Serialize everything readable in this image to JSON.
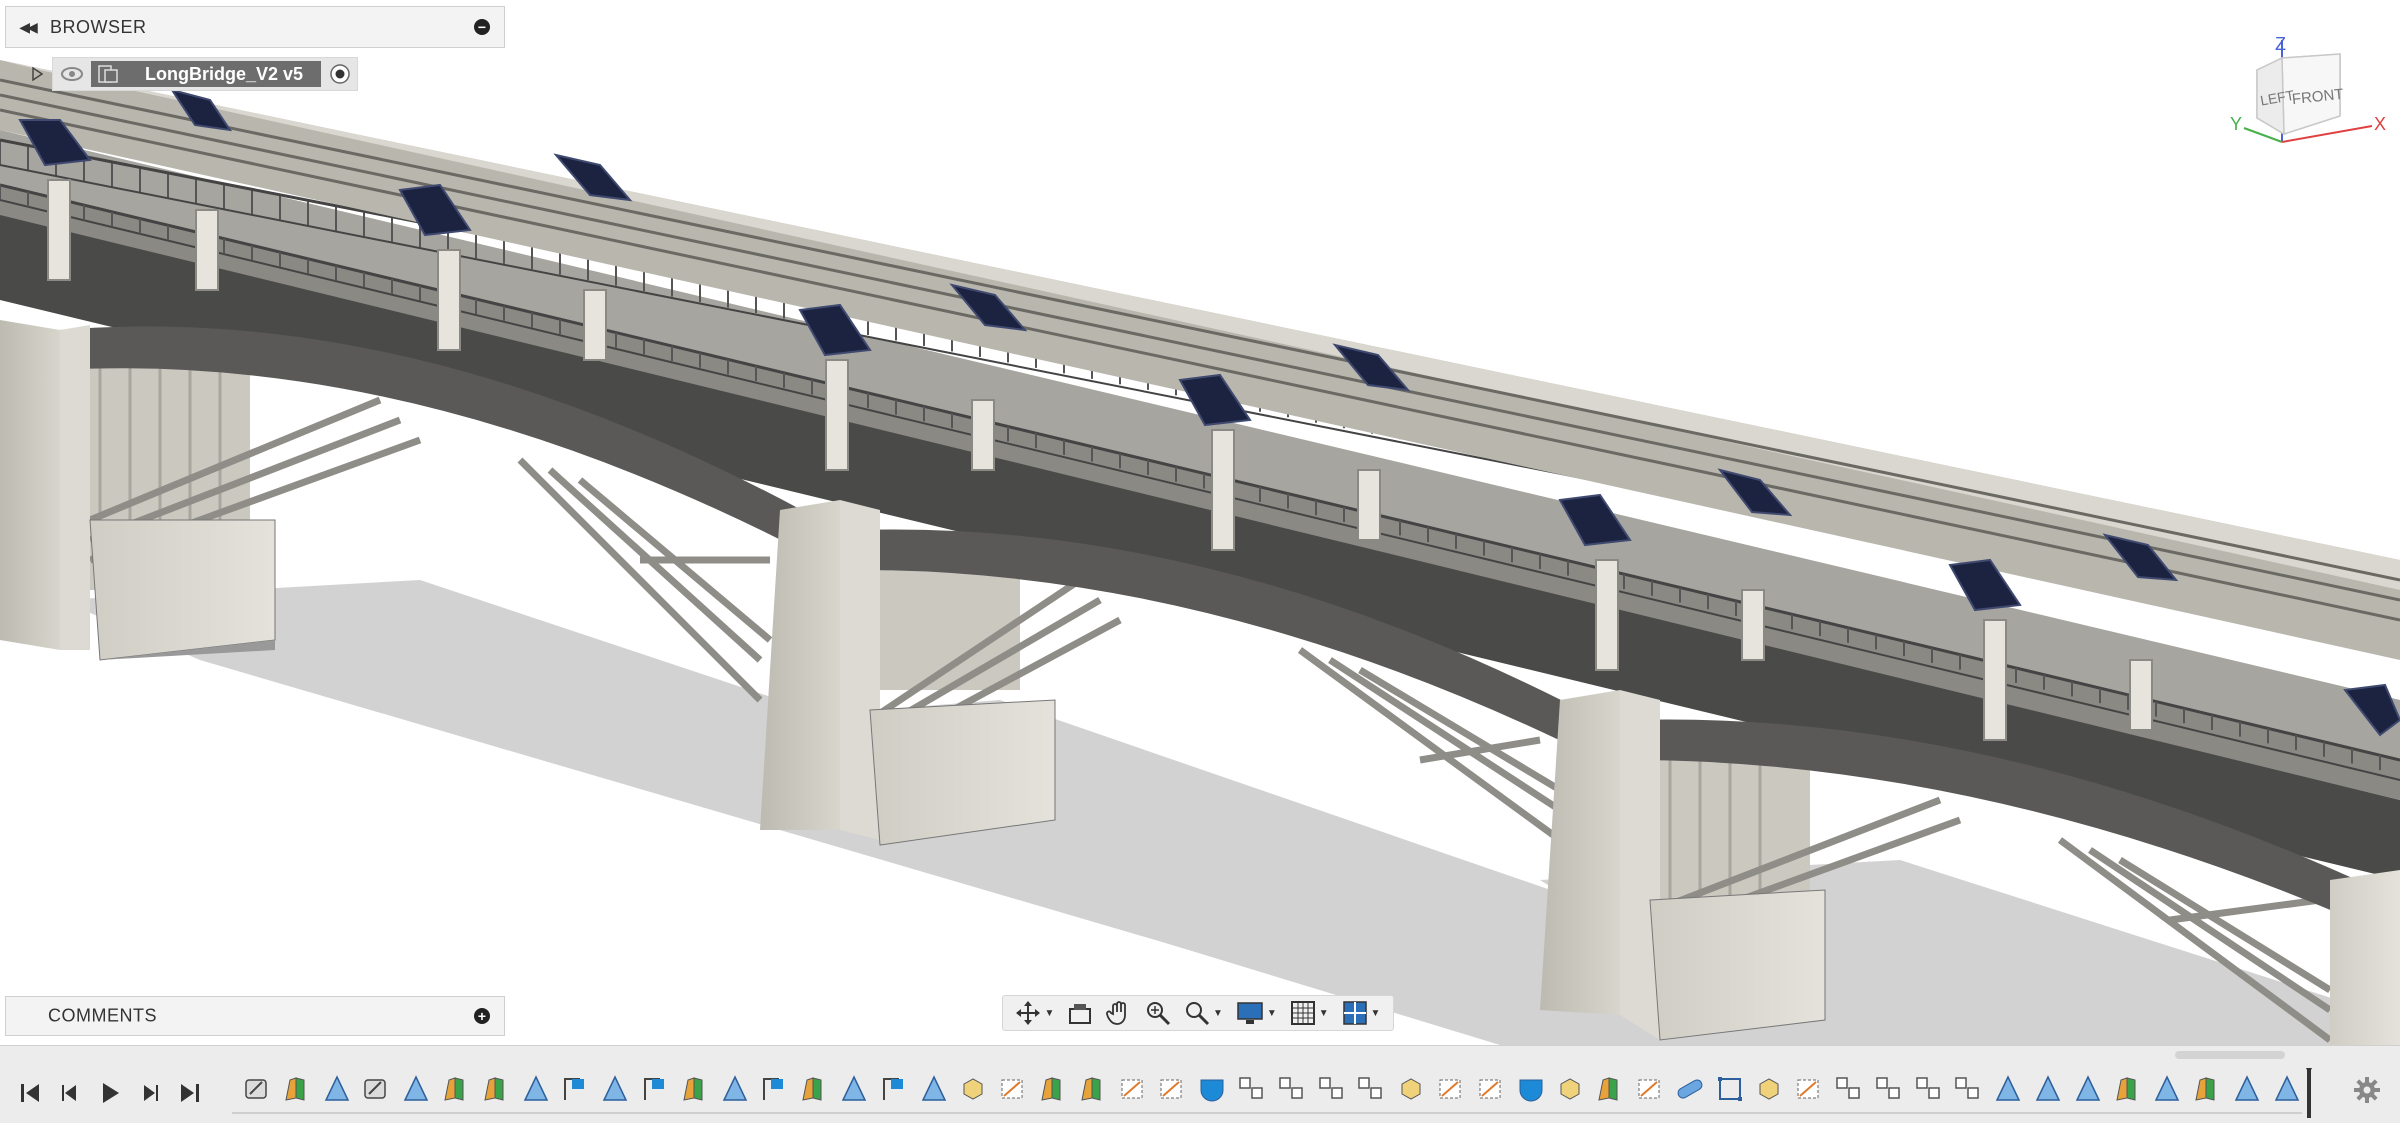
{
  "browser": {
    "title": "BROWSER",
    "component_name": "LongBridge_V2 v5"
  },
  "comments": {
    "title": "COMMENTS"
  },
  "viewcube": {
    "z_label": "Z",
    "x_label": "X",
    "y_label": "Y",
    "left_face": "LEFT",
    "front_face": "FRONT"
  },
  "navbar": {
    "tools": [
      "orbit-icon",
      "look-at-icon",
      "pan-icon",
      "zoom-icon",
      "zoom-window-icon",
      "display-settings-icon",
      "grid-icon",
      "viewports-icon"
    ]
  },
  "timeline": {
    "controls": [
      "go-to-start-icon",
      "step-back-icon",
      "play-icon",
      "step-forward-icon",
      "go-to-end-icon"
    ],
    "features": [
      "fillet-icon",
      "extrude-icon",
      "sweep-icon",
      "fillet-icon",
      "sweep-icon",
      "extrude-icon",
      "extrude-icon",
      "sweep-icon",
      "sketch-icon",
      "sweep-icon",
      "sketch-icon",
      "extrude-icon",
      "sweep-icon",
      "sketch-icon",
      "extrude-icon",
      "sweep-icon",
      "sketch-icon",
      "sweep-icon",
      "solid-icon",
      "offset-plane-icon",
      "extrude-icon",
      "extrude-icon",
      "offset-plane-icon",
      "offset-plane-icon",
      "shell-icon",
      "pattern-icon",
      "pattern-icon",
      "pattern-icon",
      "pattern-icon",
      "solid-icon",
      "offset-plane-icon",
      "offset-plane-icon",
      "shell-icon",
      "solid-icon",
      "extrude-icon",
      "offset-plane-icon",
      "pipe-icon",
      "rectangle-icon",
      "solid-icon",
      "offset-plane-icon",
      "pattern-icon",
      "pattern-icon",
      "pattern-icon",
      "pattern-icon",
      "sweep-icon",
      "sweep-icon",
      "sweep-icon",
      "extrude-icon",
      "sweep-icon",
      "extrude-icon",
      "sweep-icon",
      "sweep-icon"
    ]
  },
  "colors": {
    "accent_blue": "#1d8ad8",
    "panel_bg": "#f3f3f3",
    "component_chip": "#6d6d6d"
  }
}
